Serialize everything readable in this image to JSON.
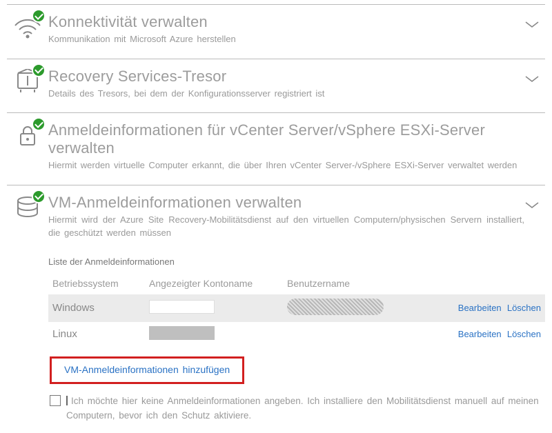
{
  "sections": [
    {
      "title": "Konnektivität verwalten",
      "subtitle": "Kommunikation mit Microsoft Azure herstellen"
    },
    {
      "title": "Recovery Services-Tresor",
      "subtitle": "Details des Tresors, bei dem der Konfigurationsserver registriert ist"
    },
    {
      "title": "Anmeldeinformationen für vCenter Server/vSphere ESXi-Server verwalten",
      "subtitle": "Hiermit werden virtuelle Computer erkannt, die über Ihren vCenter Server-/vSphere ESXi-Server verwaltet werden"
    },
    {
      "title": "VM-Anmeldeinformationen verwalten",
      "subtitle": "Hiermit wird der Azure Site Recovery-Mobilitätsdienst auf den virtuellen Computern/physischen Servern installiert, die geschützt werden müssen"
    }
  ],
  "creds": {
    "list_header": "Liste der Anmeldeinformationen",
    "cols": {
      "os": "Betriebssystem",
      "acct": "Angezeigter Kontoname",
      "user": "Benutzername"
    },
    "rows": [
      {
        "os": "Windows",
        "edit": "Bearbeiten",
        "delete": "Löschen"
      },
      {
        "os": "Linux",
        "edit": "Bearbeiten",
        "delete": "Löschen"
      }
    ],
    "add_link": "VM-Anmeldeinformationen  hinzufügen",
    "opt_out": "Ich möchte hier keine Anmeldeinformationen angeben. Ich installiere den Mobilitätsdienst manuell auf meinen Computern, bevor ich den Schutz aktiviere."
  }
}
